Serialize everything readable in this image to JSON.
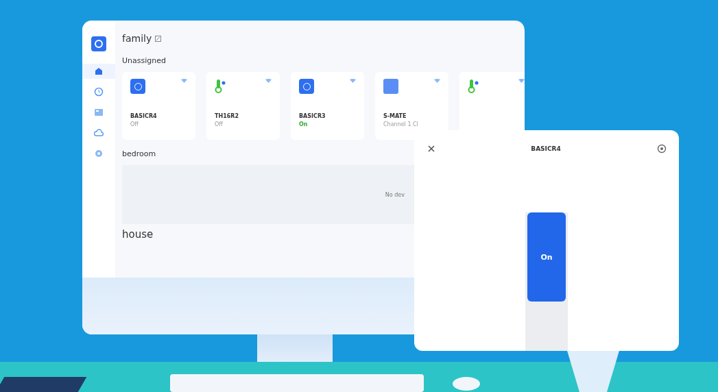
{
  "app": {
    "home_title": "family",
    "sidebar": [
      {
        "kind": "home",
        "selected": true
      },
      {
        "kind": "clock",
        "selected": false
      },
      {
        "kind": "panel",
        "selected": false
      },
      {
        "kind": "cloud",
        "selected": false
      },
      {
        "kind": "gear",
        "selected": false
      }
    ],
    "sections": [
      {
        "title": "Unassigned",
        "kind": "cards",
        "devices": [
          {
            "name": "BASICR4",
            "status": "Off",
            "on": false,
            "kind": "plug"
          },
          {
            "name": "TH16R2",
            "status": "Off",
            "on": false,
            "kind": "thermo"
          },
          {
            "name": "BASICR3",
            "status": "On",
            "on": true,
            "kind": "plug"
          },
          {
            "name": "S-MATE",
            "status": "Channel 1 Cl",
            "on": false,
            "kind": "square"
          },
          {
            "kind": "thermo"
          }
        ]
      },
      {
        "title": "bedroom",
        "kind": "empty",
        "note": "No dev"
      },
      {
        "title": "house",
        "kind": "cards"
      }
    ]
  },
  "dialog": {
    "title": "BASICR4",
    "switch": {
      "label": "On",
      "on": true
    }
  }
}
